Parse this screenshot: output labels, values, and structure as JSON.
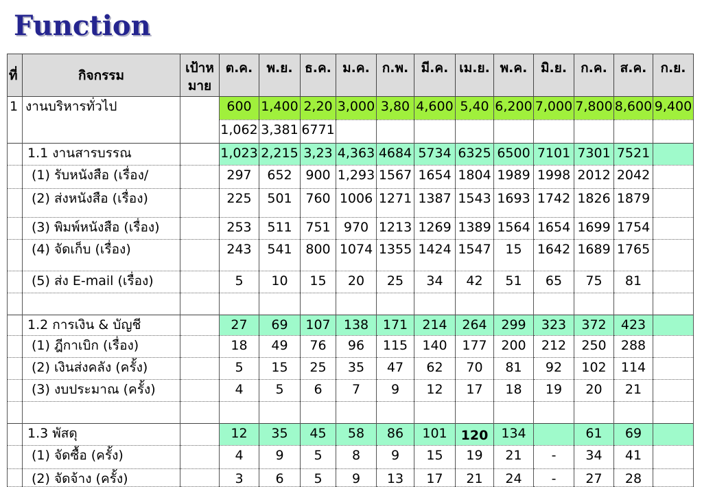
{
  "title": "Function",
  "colors": {
    "title": "#25258f",
    "title_shadow": "#b4b4c6",
    "header_bg": "#dcdcdc",
    "grid_line": "#555555"
  },
  "table": {
    "headers": {
      "no": "ที่",
      "activity": "กิจกรรม",
      "target": [
        "เป้าห",
        "มาย"
      ],
      "months": [
        "ต.ค.",
        "พ.ย.",
        "ธ.ค.",
        "ม.ค.",
        "ก.พ.",
        "มี.ค.",
        "เม.ย.",
        "พ.ค.",
        "มิ.ย.",
        "ก.ค.",
        "ส.ค.",
        "ก.ย."
      ]
    },
    "rows": [
      {
        "level": 0,
        "no": "1",
        "activity": "งานบริหารทั่วไป",
        "fill": "#a0f03c",
        "values": [
          "600",
          "1,400",
          "2,20",
          "3,000",
          "3,80",
          "4,600",
          "5,40",
          "6,200",
          "7,000",
          "7,800",
          "8,600",
          "9,400"
        ]
      },
      {
        "continuation": true,
        "values": [
          "1,062",
          "3,381",
          "6771"
        ]
      },
      {
        "level": 1,
        "activity": "1.1 งานสารบรรณ",
        "fill": "#9ffacb",
        "values": [
          "1,023",
          "2,215",
          "3,23",
          "4,363",
          "4684",
          "5734",
          "6325",
          "6500",
          "7101",
          "7301",
          "7521",
          ""
        ]
      },
      {
        "level": 2,
        "activity": "(1) รับหนังสือ (เรื่อง/",
        "values": [
          "297",
          "652",
          "900",
          "1,293",
          "1567",
          "1654",
          "1804",
          "1989",
          "1998",
          "2012",
          "2042"
        ]
      },
      {
        "level": 2,
        "activity": "(2) ส่งหนังสือ (เรื่อง)",
        "values": [
          "225",
          "501",
          "760",
          "1006",
          "1271",
          "1387",
          "1543",
          "1693",
          "1742",
          "1826",
          "1879"
        ]
      },
      {
        "level": 2,
        "activity": "(3) พิมพ์หนังสือ (เรื่อง)",
        "values": [
          "253",
          "511",
          "751",
          "970",
          "1213",
          "1269",
          "1389",
          "1564",
          "1654",
          "1699",
          "1754"
        ]
      },
      {
        "level": 2,
        "activity": "(4) จัดเก็บ (เรื่อง)",
        "values": [
          "243",
          "541",
          "800",
          "1074",
          "1355",
          "1424",
          "1547",
          "15",
          "1642",
          "1689",
          "1765"
        ]
      },
      {
        "level": 2,
        "activity": "(5) ส่ง E-mail (เรื่อง)",
        "values": [
          "5",
          "10",
          "15",
          "20",
          "25",
          "34",
          "42",
          "51",
          "65",
          "75",
          "81"
        ]
      },
      {
        "blank": true
      },
      {
        "level": 1,
        "activity": "1.2 การเงิน & บัญชี",
        "fill": "#9ffacb",
        "values": [
          "27",
          "69",
          "107",
          "138",
          "171",
          "214",
          "264",
          "299",
          "323",
          "372",
          "423",
          ""
        ]
      },
      {
        "level": 2,
        "activity": "(1) ฎีกาเบิก (เรื่อง)",
        "values": [
          "18",
          "49",
          "76",
          "96",
          "115",
          "140",
          "177",
          "200",
          "212",
          "250",
          "288"
        ]
      },
      {
        "level": 2,
        "activity": "(2) เงินส่งคลัง (ครั้ง)",
        "values": [
          "5",
          "15",
          "25",
          "35",
          "47",
          "62",
          "70",
          "81",
          "92",
          "102",
          "114"
        ]
      },
      {
        "level": 2,
        "activity": "(3) งบประมาณ (ครั้ง)",
        "values": [
          "4",
          "5",
          "6",
          "7",
          "9",
          "12",
          "17",
          "18",
          "19",
          "20",
          "21"
        ]
      },
      {
        "blank": true
      },
      {
        "level": 1,
        "activity": "1.3 พัสดุ",
        "fill": "#9ffacb",
        "values": [
          "12",
          "35",
          "45",
          "58",
          "86",
          "101",
          {
            "text": "120",
            "bold": true
          },
          "134",
          "",
          "61",
          "69",
          ""
        ]
      },
      {
        "level": 2,
        "activity": "(1) จัดซื้อ (ครั้ง)",
        "values": [
          "4",
          "9",
          "5",
          "8",
          "9",
          "15",
          "19",
          "21",
          "-",
          "34",
          "41"
        ]
      },
      {
        "level": 2,
        "activity": "(2) จัดจ้าง (ครั้ง)",
        "values": [
          "3",
          "6",
          "5",
          "9",
          "13",
          "17",
          "21",
          "24",
          "-",
          "27",
          "28"
        ]
      }
    ]
  }
}
